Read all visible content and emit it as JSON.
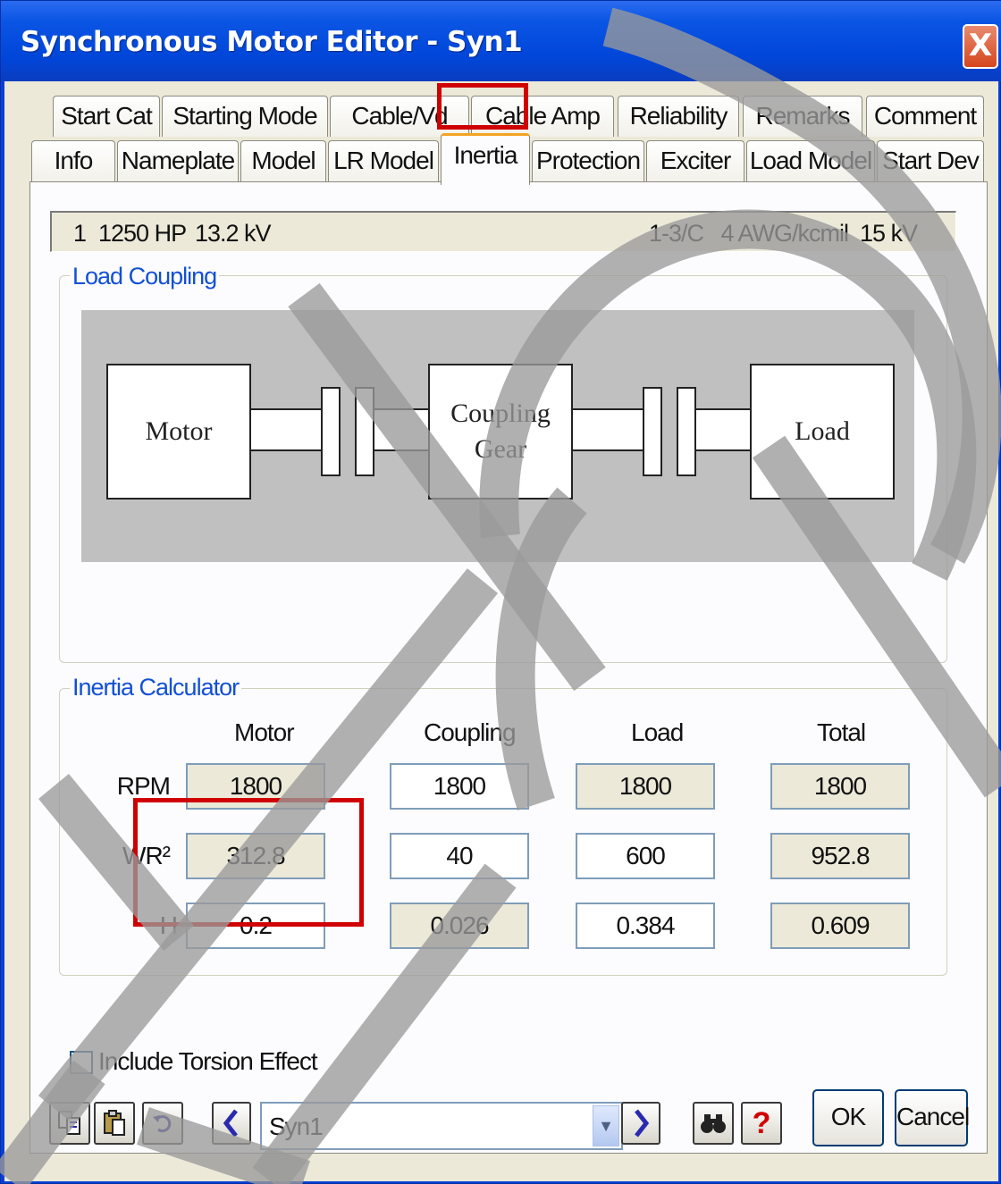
{
  "window": {
    "title": "Synchronous Motor Editor - Syn1",
    "close_label": "X"
  },
  "tabs": {
    "row1": [
      "Start Cat",
      "Starting Mode",
      "Cable/Vd",
      "Cable Amp",
      "Reliability",
      "Remarks",
      "Comment"
    ],
    "row2": [
      "Info",
      "Nameplate",
      "Model",
      "LR Model",
      "Inertia",
      "Protection",
      "Exciter",
      "Load Model",
      "Start Dev"
    ],
    "active": "Inertia"
  },
  "infobar": {
    "id": "1",
    "rating": "1250 HP",
    "voltage": "13.2 kV",
    "cable": "1-3/C   4 AWG/kcmil  15 kV"
  },
  "load_coupling": {
    "label": "Load Coupling",
    "motor": "Motor",
    "coupling": "Coupling Gear",
    "load": "Load"
  },
  "inertia_calculator": {
    "label": "Inertia Calculator",
    "columns": [
      "Motor",
      "Coupling",
      "Load",
      "Total"
    ],
    "rows": [
      {
        "label": "RPM",
        "values": [
          "1800",
          "1800",
          "1800",
          "1800"
        ]
      },
      {
        "label": "WR²",
        "values": [
          "312.8",
          "40",
          "600",
          "952.8"
        ]
      },
      {
        "label": "H",
        "values": [
          "0.2",
          "0.026",
          "0.384",
          "0.609"
        ]
      }
    ]
  },
  "torsion": {
    "label": "Include Torsion Effect",
    "checked": false
  },
  "footer": {
    "combo_value": "Syn1",
    "ok_label": "OK",
    "cancel_label": "Cancel",
    "help_label": "?"
  },
  "colors": {
    "titlebar": "#0046d9",
    "group_label": "#1250d4",
    "highlight": "#d00000",
    "dialog_bg": "#ece9d8"
  }
}
